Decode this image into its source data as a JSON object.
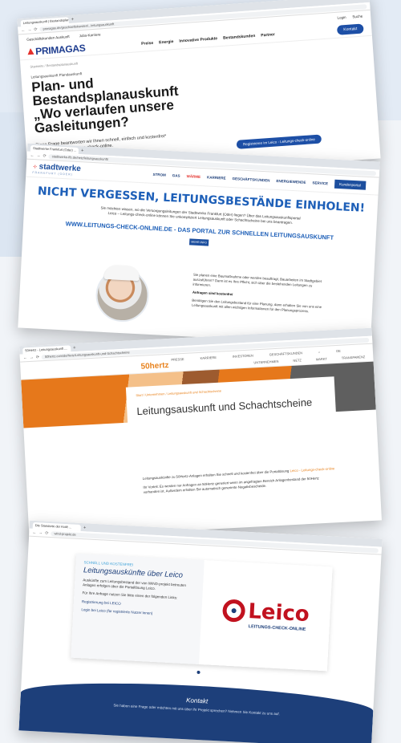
{
  "shot1": {
    "tab": "Leitungsauskunft | Bestandsplan...",
    "url": "primagas.de/geschaeftskunden/...leitungsauskunft",
    "top_links": [
      "Geschäftskunden Auskunft",
      "Jobs-Karriere"
    ],
    "top_right": [
      "Login",
      "Suche"
    ],
    "brand": "PRIMAGAS",
    "nav": [
      "Preise",
      "Energie",
      "Innovative Produkte",
      "Bestandskunden",
      "Partner"
    ],
    "contact": "Kontakt",
    "breadcrumb": "Startseite / Bestandsplanauskunft",
    "eyebrow": "Leitungsauskunft Plandauskunft",
    "headline": "Plan- und Bestandsplanauskunft „Wo verlaufen unsere Gasleitungen?",
    "text": "Diese Frage beantworten wir Ihnen schnell, einfach und kostenfrei* über den Leico - Leitungs-check-online.",
    "button": "Registrieren im Leico - Leitungs-check-online"
  },
  "shot2": {
    "tab": "Stadtwerke Frankfurt (Oder) ...",
    "url": "stadtwerke-ffo.de/netz/leitungsauskunft/",
    "brand_name": "stadtwerke",
    "brand_sub": "FRANKFURT (ODER)",
    "nav": [
      "STROM",
      "GAS",
      "WÄRME",
      "KARRIERE",
      "GESCHÄFTSKUNDEN",
      "ENERGIEWENDE",
      "SERVICE"
    ],
    "portal": "Kundenportal",
    "title": "NICHT VERGESSEN, LEITUNGSBESTÄNDE EINHOLEN!",
    "intro": "Sie möchten wissen, wo die Versorgungsleitungen der Stadtwerke Frankfurt (Oder) liegen? Über das Leitungsauskunftsportal Leico – Leitungs-check-online können Sie unkompliziert Leitungsauskunft oder Schachtscheine bei uns beantragen.",
    "link": "WWW.LEITUNGS-CHECK-ONLINE.DE - DAS PORTAL ZUR SCHNELLEN LEITUNGSAUSKUNFT",
    "more": "MEHR INFO",
    "body_1": "Sie planen eine Baumaßnahme oder werden beauftragt, Bauarbeiten im Stadtgebiet auszuführen? Dann ist es Ihre Pflicht, sich über die bestehenden Leitungen zu informieren.",
    "body_bold": "Anfragen sind kostenfrei",
    "body_2": "Benötigen Sie den Leitungsbestand für eine Planung, dann erhalten Sie von uns eine Leitungsauskunft mit allen wichtigen Informationen für den Planungsprozess."
  },
  "shot3": {
    "tab": "50Hertz - Leitungsauskunft ...",
    "url": "50hertz.com/de/Netz/Leitungsauskunft-und-Schachtscheine",
    "menu_top": [
      "PRESSE",
      "KARRIERE",
      "INVESTOREN",
      "GESCHÄFTSKUNDEN",
      "DE"
    ],
    "menu_bottom": [
      "UNTERNEHMEN",
      "NETZ",
      "MARKT",
      "TRANSPARENZ"
    ],
    "brand_prefix": "50",
    "brand_suffix": "hertz",
    "breadcrumb": "Start / Unternehmen / Leitungsauskunft und Schachtscheine",
    "title": "Leitungsauskunft und Schachtscheine",
    "text_1": "Leitungsauskünfte zu 50Hertz-Anlagen erhalten Sie schnell und kostenfrei über die Portallösung",
    "text_link": "Leico - Leitungs-check-online",
    "text_2": "Ihr Vorteil: Es werden nur Anfragen an 50Hertz generiert wenn im angefragten Bereich Anlagenbestand der 50Hertz vorhanden ist. Außerdem erhalten Sie automatisch generierte Negativbescheide."
  },
  "shot4": {
    "tab": "Die Standorte der Kraft ...",
    "url": "wind-projekt.de",
    "eyebrow": "SCHNELL UND KOSTENFREI",
    "title": "Leitungsauskünfte über Leico",
    "text": "Auskünfte zum Leitungsbestand der von WIND-projekt betreuten Anlagen erfolgen über die Portallösung Leico.",
    "cta": "Für Ihre Anfrage nutzen Sie bitte einen der folgenden Links:",
    "link_register": "Registrierung bei LEICO",
    "link_login": "Login bei Leico (für registrierte Nutzer:innen)",
    "logo_word": "Leico",
    "logo_sub": "LEITUNGS-CHECK-ONLINE",
    "footer_title": "Kontakt",
    "footer_text": "Sie haben eine Frage oder möchten mit uns über Ihr Projekt sprechen? Nehmen Sie Kontakt zu uns auf."
  }
}
